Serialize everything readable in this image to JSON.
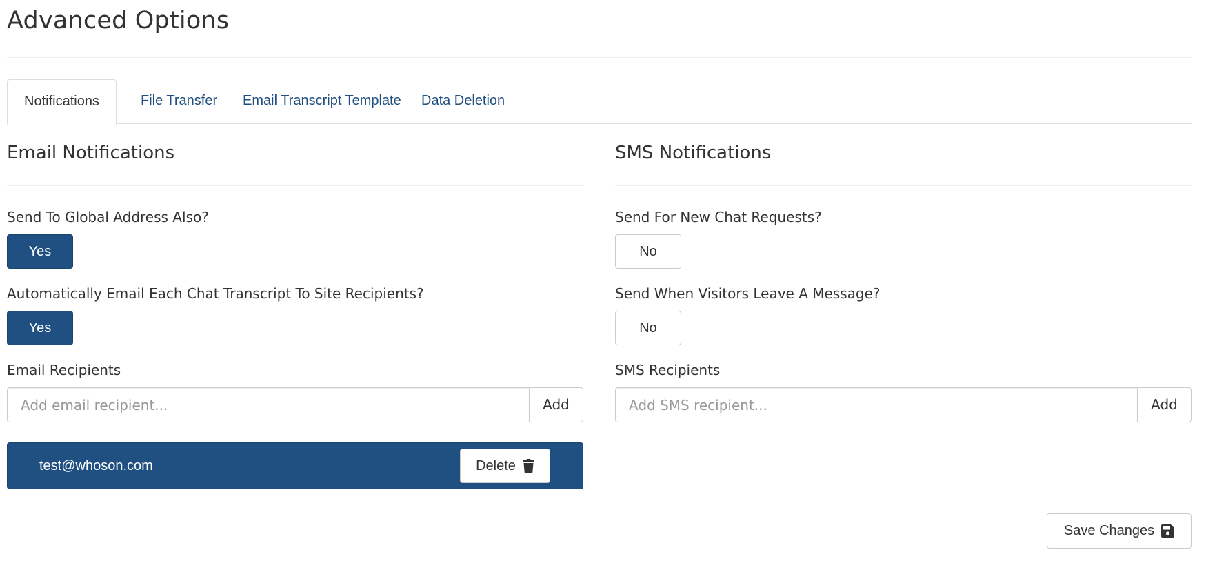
{
  "header": {
    "title": "Advanced Options"
  },
  "tabs": [
    {
      "label": "Notifications",
      "active": true
    },
    {
      "label": "File Transfer",
      "active": false
    },
    {
      "label": "Email Transcript Template",
      "active": false
    },
    {
      "label": "Data Deletion",
      "active": false
    }
  ],
  "email": {
    "title": "Email Notifications",
    "global_label": "Send To Global Address Also?",
    "global_value": "Yes",
    "auto_label": "Automatically Email Each Chat Transcript To Site Recipients?",
    "auto_value": "Yes",
    "recipients_label": "Email Recipients",
    "input_placeholder": "Add email recipient...",
    "input_value": "",
    "add_label": "Add",
    "recipients": [
      {
        "address": "test@whoson.com",
        "delete_label": "Delete",
        "delete_icon": "trash-icon"
      }
    ]
  },
  "sms": {
    "title": "SMS Notifications",
    "new_chat_label": "Send For New Chat Requests?",
    "new_chat_value": "No",
    "leave_msg_label": "Send When Visitors Leave A Message?",
    "leave_msg_value": "No",
    "recipients_label": "SMS Recipients",
    "input_placeholder": "Add SMS recipient...",
    "input_value": "",
    "add_label": "Add"
  },
  "footer": {
    "save_label": "Save Changes",
    "save_icon": "floppy-disk-icon"
  },
  "colors": {
    "primary": "#1f5081",
    "link": "#1f4e7f",
    "text": "#333333",
    "border": "#cccccc"
  }
}
